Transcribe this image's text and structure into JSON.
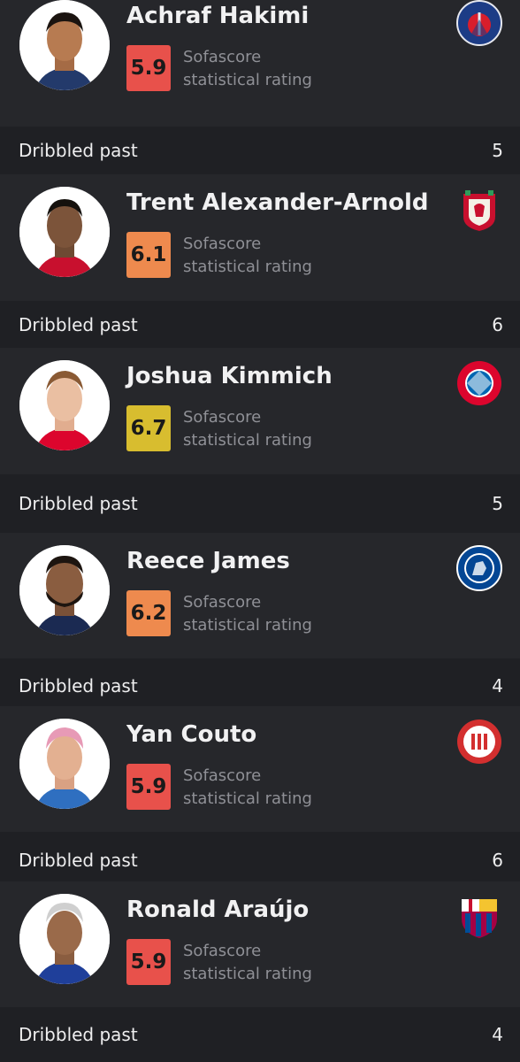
{
  "rating_caption_line1": "Sofascore",
  "rating_caption_line2": "statistical rating",
  "players": [
    {
      "name": "Achraf Hakimi",
      "rating": "5.9",
      "rating_color": "#e8514b",
      "club_icon": "psg-crest-icon",
      "stat_label": "Dribbled past",
      "stat_value": "5"
    },
    {
      "name": "Trent Alexander-Arnold",
      "rating": "6.1",
      "rating_color": "#ee8a4e",
      "club_icon": "liverpool-crest-icon",
      "stat_label": "Dribbled past",
      "stat_value": "6"
    },
    {
      "name": "Joshua Kimmich",
      "rating": "6.7",
      "rating_color": "#d8bd2f",
      "club_icon": "bayern-crest-icon",
      "stat_label": "Dribbled past",
      "stat_value": "5"
    },
    {
      "name": "Reece James",
      "rating": "6.2",
      "rating_color": "#ee8a4e",
      "club_icon": "chelsea-crest-icon",
      "stat_label": "Dribbled past",
      "stat_value": "4"
    },
    {
      "name": "Yan Couto",
      "rating": "5.9",
      "rating_color": "#e8514b",
      "club_icon": "girona-crest-icon",
      "stat_label": "Dribbled past",
      "stat_value": "6"
    },
    {
      "name": "Ronald Araújo",
      "rating": "5.9",
      "rating_color": "#e8514b",
      "club_icon": "barcelona-crest-icon",
      "stat_label": "Dribbled past",
      "stat_value": "4"
    }
  ]
}
